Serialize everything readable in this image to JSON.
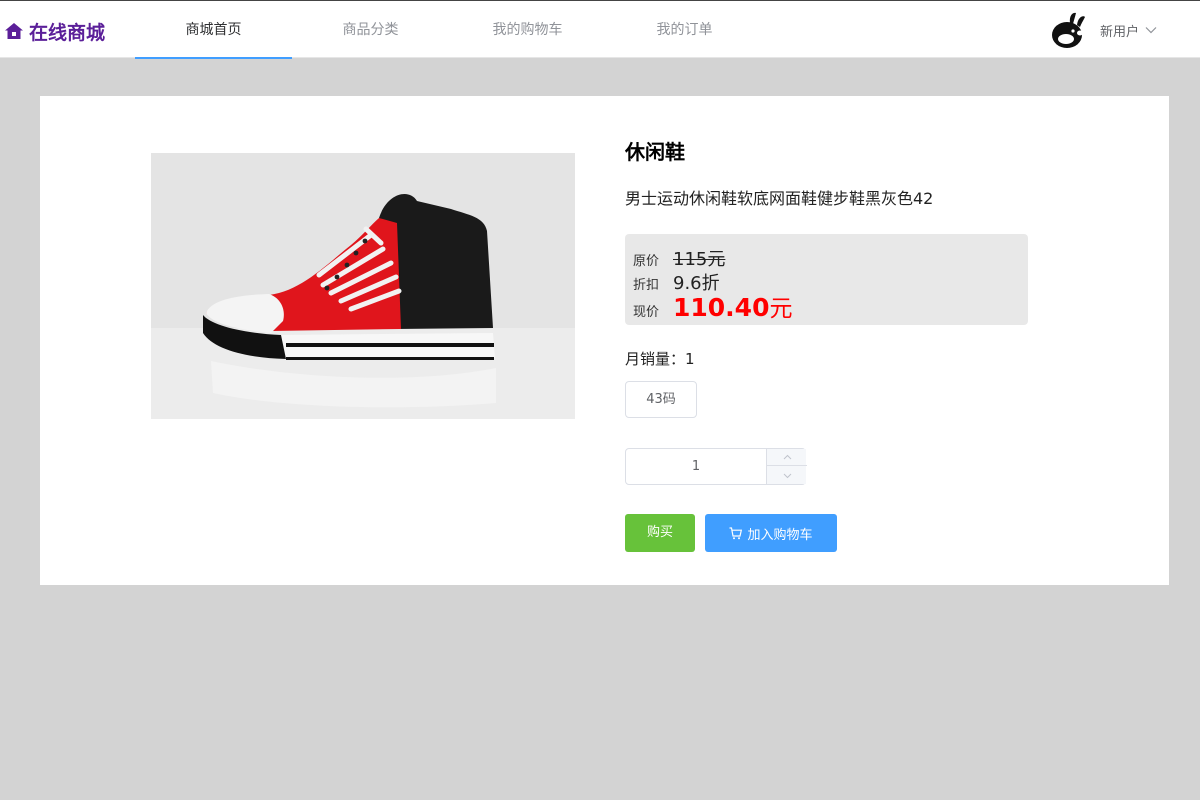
{
  "header": {
    "logo_text": "在线商城",
    "logo_icon": "home-icon",
    "nav": [
      {
        "label": "商城首页",
        "active": true
      },
      {
        "label": "商品分类",
        "active": false
      },
      {
        "label": "我的购物车",
        "active": false
      },
      {
        "label": "我的订单",
        "active": false
      }
    ],
    "user_name": "新用户",
    "accent_color": "#409eff",
    "logo_color": "#5b1f99"
  },
  "product": {
    "name": "休闲鞋",
    "description": "男士运动休闲鞋软底网面鞋健步鞋黑灰色42",
    "original_price_label": "原价",
    "original_price": "115元",
    "discount_label": "折扣",
    "discount": "9.6折",
    "current_price_label": "现价",
    "current_price": "110.40",
    "current_price_unit": "元",
    "monthly_sales_label": "月销量：",
    "monthly_sales": "1",
    "size_option": "43码",
    "quantity": "1",
    "image_icon": "sneaker-image"
  },
  "actions": {
    "buy_label": "购买",
    "add_to_cart_label": "加入购物车",
    "buy_color": "#67c23a",
    "cart_color": "#409eff",
    "price_color": "#ff0000"
  }
}
